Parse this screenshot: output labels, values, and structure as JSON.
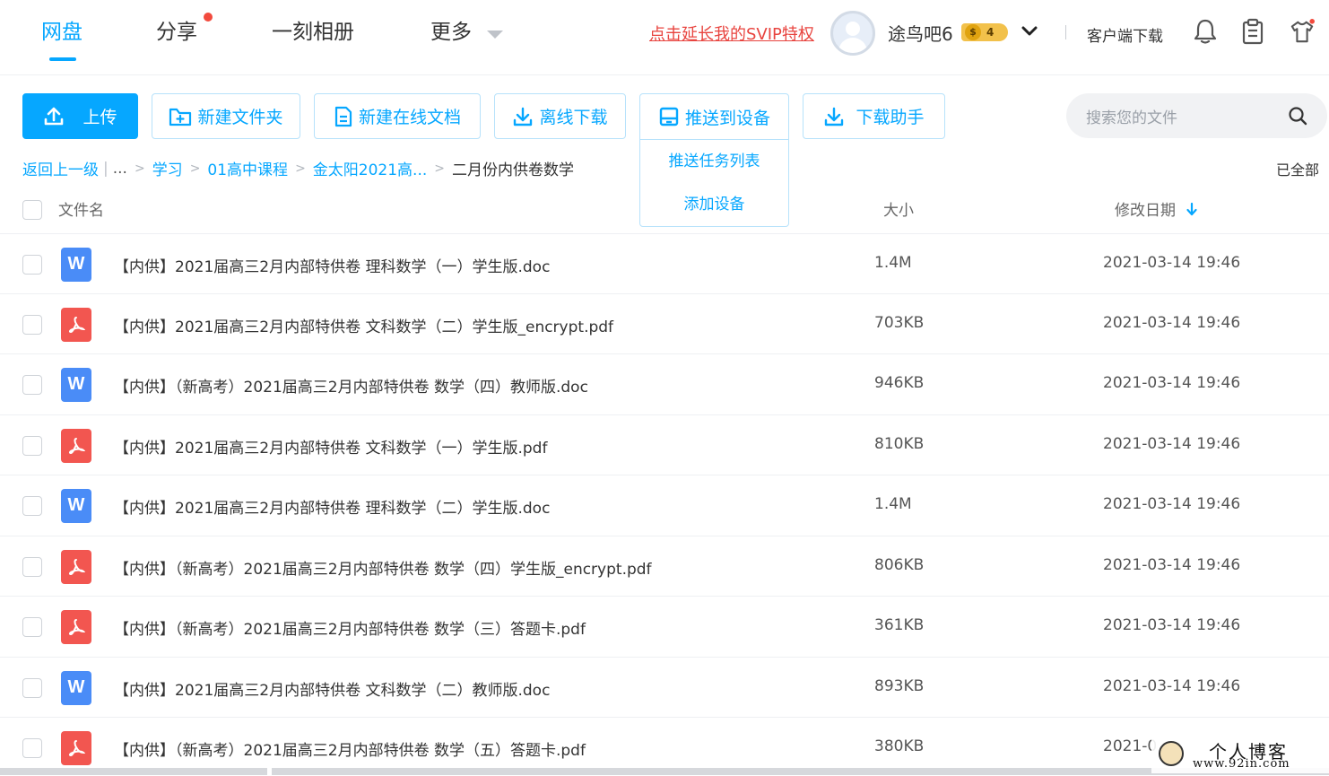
{
  "nav": {
    "tabs": [
      "网盘",
      "分享",
      "一刻相册",
      "更多"
    ],
    "active": "网盘"
  },
  "header": {
    "svip_link": "点击延长我的SVIP特权",
    "username": "途鸟吧6",
    "vip_coin": "$",
    "vip_level": "4",
    "client_download": "客户端下载"
  },
  "toolbar": {
    "upload": "上传",
    "new_folder": "新建文件夹",
    "new_online_doc": "新建在线文档",
    "offline_download": "离线下载",
    "push_to_device": "推送到设备",
    "push_task_list": "推送任务列表",
    "add_device": "添加设备",
    "download_assistant": "下载助手"
  },
  "search": {
    "placeholder": "搜索您的文件"
  },
  "breadcrumb": {
    "back": "返回上一级",
    "ellipsis": "...",
    "items": [
      "学习",
      "01高中课程",
      "金太阳2021高..."
    ],
    "current": "二月份内供卷数学",
    "loaded_all": "已全部"
  },
  "table": {
    "headers": {
      "name": "文件名",
      "size": "大小",
      "modified": "修改日期"
    },
    "rows": [
      {
        "type": "doc",
        "name": "【内供】2021届高三2月内部特供卷 理科数学（一）学生版.doc",
        "size": "1.4M",
        "date": "2021-03-14 19:46"
      },
      {
        "type": "pdf",
        "name": "【内供】2021届高三2月内部特供卷 文科数学（二）学生版_encrypt.pdf",
        "size": "703KB",
        "date": "2021-03-14 19:46"
      },
      {
        "type": "doc",
        "name": "【内供】（新高考）2021届高三2月内部特供卷 数学（四）教师版.doc",
        "size": "946KB",
        "date": "2021-03-14 19:46"
      },
      {
        "type": "pdf",
        "name": "【内供】2021届高三2月内部特供卷 文科数学（一）学生版.pdf",
        "size": "810KB",
        "date": "2021-03-14 19:46"
      },
      {
        "type": "doc",
        "name": "【内供】2021届高三2月内部特供卷 理科数学（二）学生版.doc",
        "size": "1.4M",
        "date": "2021-03-14 19:46"
      },
      {
        "type": "pdf",
        "name": "【内供】（新高考）2021届高三2月内部特供卷 数学（四）学生版_encrypt.pdf",
        "size": "806KB",
        "date": "2021-03-14 19:46"
      },
      {
        "type": "pdf",
        "name": "【内供】（新高考）2021届高三2月内部特供卷 数学（三）答题卡.pdf",
        "size": "361KB",
        "date": "2021-03-14 19:46"
      },
      {
        "type": "doc",
        "name": "【内供】2021届高三2月内部特供卷 文科数学（二）教师版.doc",
        "size": "893KB",
        "date": "2021-03-14 19:46"
      },
      {
        "type": "pdf",
        "name": "【内供】（新高考）2021届高三2月内部特供卷 数学（五）答题卡.pdf",
        "size": "380KB",
        "date": "2021-0"
      }
    ]
  },
  "watermark": {
    "title": "个人博客",
    "url": "www.92in.com"
  },
  "colors": {
    "accent": "#06a7ff",
    "doc_icon": "#4a8cf7",
    "pdf_icon": "#f25650",
    "svip": "#e8443f",
    "badge": "#f2c14b"
  },
  "icons": {
    "upload": "upload-icon",
    "new_folder": "folder-plus-icon",
    "online_doc": "document-icon",
    "offline": "download-icon",
    "device": "device-icon",
    "assistant": "download-icon",
    "bell": "bell-icon",
    "clipboard": "clipboard-icon",
    "shirt": "shirt-icon",
    "search": "search-icon"
  }
}
